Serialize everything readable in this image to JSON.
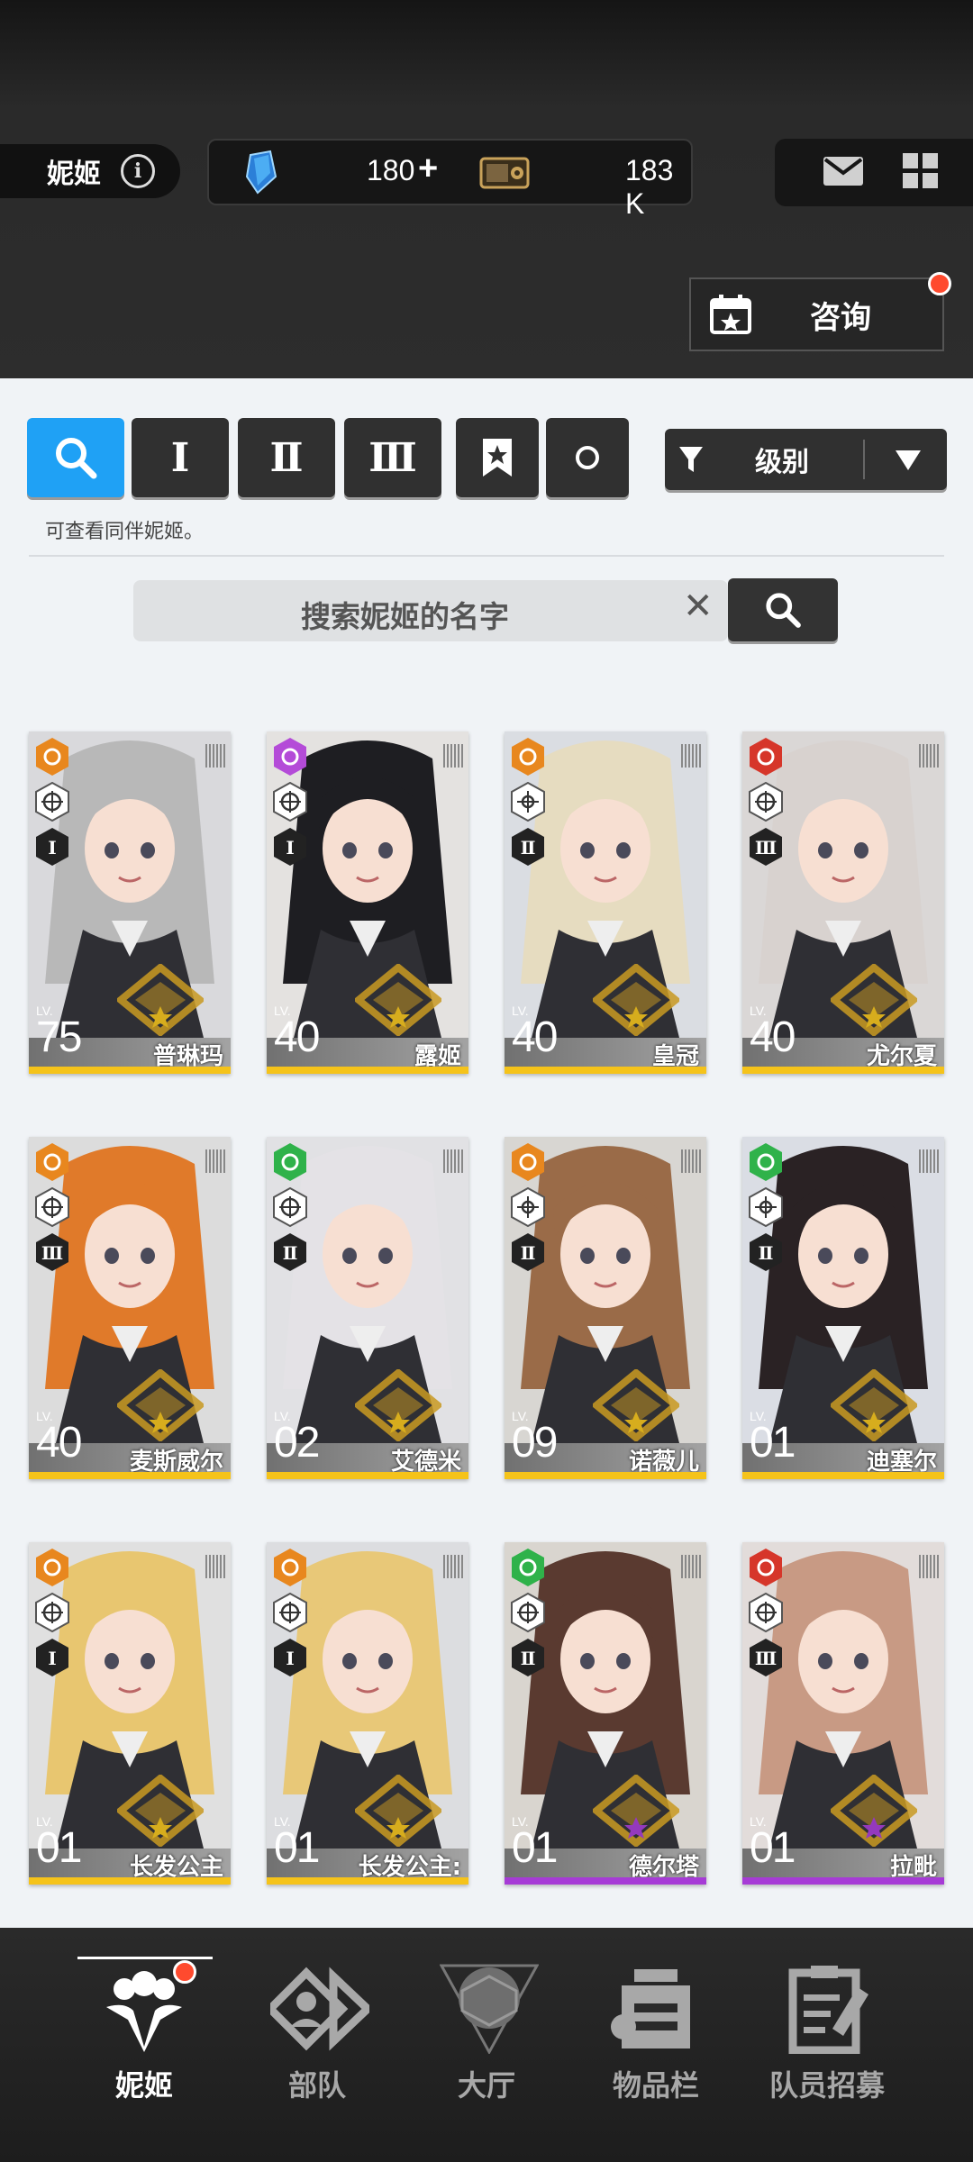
{
  "header": {
    "title": "妮姬",
    "gems": "180",
    "gems_plus": "+",
    "credits": "183 K",
    "consult_label": "咨询"
  },
  "filters": {
    "tabs": [
      {
        "label": "search",
        "icon": "search-icon",
        "active": true
      },
      {
        "label": "Ⅰ",
        "active": false
      },
      {
        "label": "Ⅱ",
        "active": false
      },
      {
        "label": "Ⅲ",
        "active": false
      },
      {
        "label": "bookmark",
        "icon": "bookmark-icon",
        "active": false
      },
      {
        "label": "circle",
        "icon": "circle-icon",
        "active": false
      }
    ],
    "sort_label": "级别",
    "hint": "可查看同伴妮姬。",
    "search_placeholder": "搜索妮姬的名字"
  },
  "characters": [
    {
      "name": "普琳玛",
      "lv_label": "LV.",
      "level": "75",
      "burst": "Ⅰ",
      "rarity": "SSR",
      "element": "iron",
      "elem_color": "#e8871e"
    },
    {
      "name": "露姬",
      "lv_label": "LV.",
      "level": "40",
      "burst": "Ⅰ",
      "rarity": "SSR",
      "element": "electric",
      "elem_color": "#b44bd8"
    },
    {
      "name": "皇冠",
      "lv_label": "LV.",
      "level": "40",
      "burst": "Ⅱ",
      "rarity": "SSR",
      "element": "iron",
      "elem_color": "#e8871e"
    },
    {
      "name": "尤尔夏",
      "lv_label": "LV.",
      "level": "40",
      "burst": "Ⅲ",
      "rarity": "SSR",
      "element": "fire",
      "elem_color": "#d6362a"
    },
    {
      "name": "麦斯威尔",
      "lv_label": "LV.",
      "level": "40",
      "burst": "Ⅲ",
      "rarity": "SSR",
      "element": "iron",
      "elem_color": "#e8871e"
    },
    {
      "name": "艾德米",
      "lv_label": "LV.",
      "level": "02",
      "burst": "Ⅱ",
      "rarity": "SSR",
      "element": "wind",
      "elem_color": "#2fb24a"
    },
    {
      "name": "诺薇儿",
      "lv_label": "LV.",
      "level": "09",
      "burst": "Ⅱ",
      "rarity": "SSR",
      "element": "iron",
      "elem_color": "#e8871e"
    },
    {
      "name": "迪塞尔",
      "lv_label": "LV.",
      "level": "01",
      "burst": "Ⅱ",
      "rarity": "SSR",
      "element": "wind",
      "elem_color": "#2fb24a"
    },
    {
      "name": "长发公主",
      "lv_label": "LV.",
      "level": "01",
      "burst": "Ⅰ",
      "rarity": "SSR",
      "element": "iron",
      "elem_color": "#e8871e"
    },
    {
      "name": "长发公主:",
      "lv_label": "LV.",
      "level": "01",
      "burst": "Ⅰ",
      "rarity": "SSR",
      "element": "iron",
      "elem_color": "#e8871e"
    },
    {
      "name": "德尔塔",
      "lv_label": "LV.",
      "level": "01",
      "burst": "Ⅱ",
      "rarity": "SR",
      "element": "wind",
      "elem_color": "#2fb24a"
    },
    {
      "name": "拉毗",
      "lv_label": "LV.",
      "level": "01",
      "burst": "Ⅲ",
      "rarity": "SR",
      "element": "fire",
      "elem_color": "#d6362a"
    }
  ],
  "nav": {
    "items": [
      {
        "label": "妮姬",
        "icon": "nikke-icon",
        "active": true
      },
      {
        "label": "部队",
        "icon": "squad-icon",
        "active": false
      },
      {
        "label": "大厅",
        "icon": "lobby-icon",
        "active": false
      },
      {
        "label": "物品栏",
        "icon": "inventory-icon",
        "active": false
      },
      {
        "label": "队员招募",
        "icon": "recruit-icon",
        "active": false
      }
    ]
  },
  "colors": {
    "accent": "#1fa1f5",
    "ssr_stripe": "#f5c31a",
    "sr_stripe": "#a63bd6",
    "notification": "#ff4a2e"
  }
}
